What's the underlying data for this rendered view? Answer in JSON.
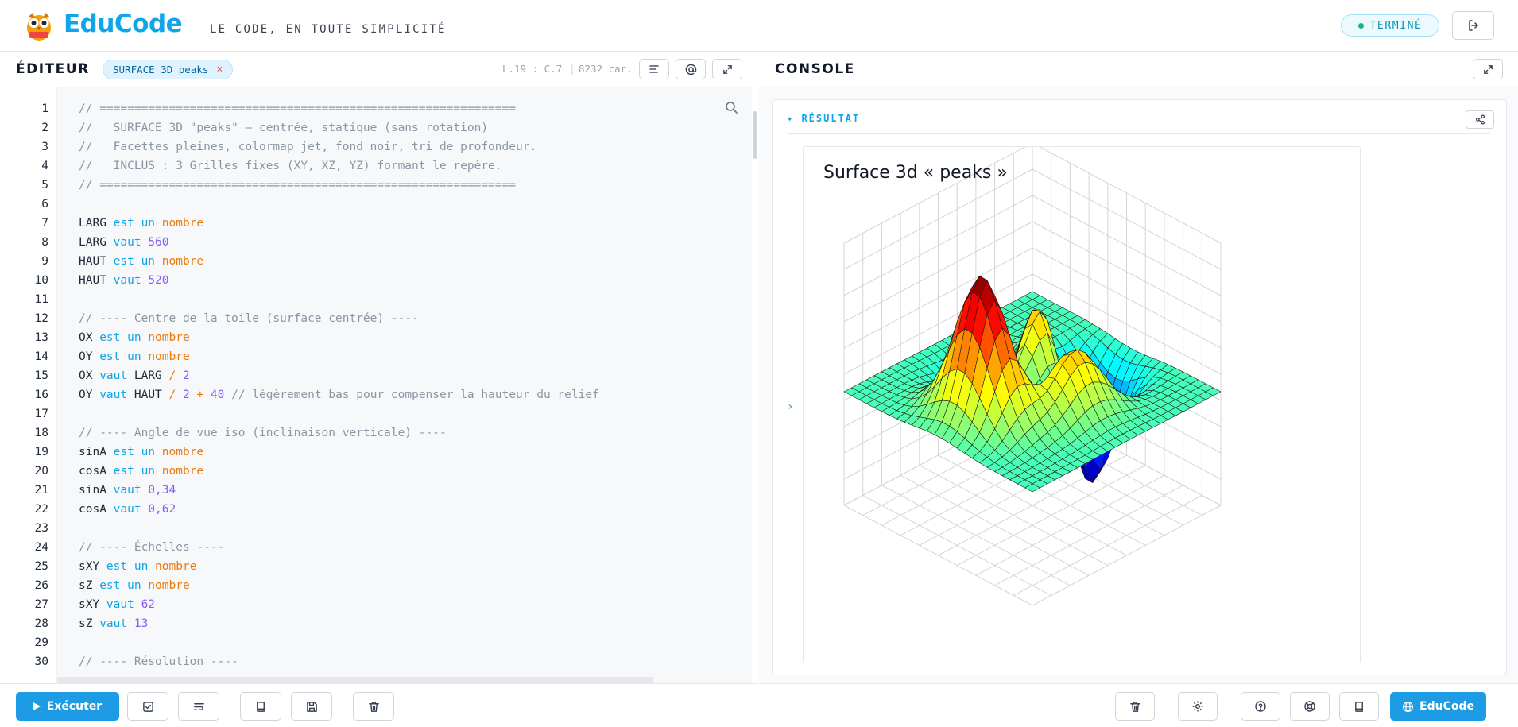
{
  "app": {
    "brand": "EduCode",
    "tagline": "LE CODE, EN TOUTE SIMPLICITÉ",
    "status": "TERMINÉ",
    "status_color": "#10b981",
    "accent": "#1d9ce5"
  },
  "editor": {
    "title": "ÉDITEUR",
    "file_tab": "SURFACE 3D peaks",
    "file_tab_close": "×",
    "cursor": "L.19 : C.7",
    "separator": "|",
    "char_count": "8232 car.",
    "line_numbers": [
      "1",
      "2",
      "3",
      "4",
      "5",
      "6",
      "7",
      "8",
      "9",
      "10",
      "11",
      "12",
      "13",
      "14",
      "15",
      "16",
      "17",
      "18",
      "19",
      "20",
      "21",
      "22",
      "23",
      "24",
      "25",
      "26",
      "27",
      "28",
      "29",
      "30"
    ],
    "lines": [
      [
        {
          "t": "// ============================================================",
          "c": "cmt"
        }
      ],
      [
        {
          "t": "//   SURFACE 3D \"peaks\" — centrée, statique (sans rotation)",
          "c": "cmt"
        }
      ],
      [
        {
          "t": "//   Facettes pleines, colormap jet, fond noir, tri de profondeur.",
          "c": "cmt"
        }
      ],
      [
        {
          "t": "//   INCLUS : 3 Grilles fixes (XY, XZ, YZ) formant le repère.",
          "c": "cmt"
        }
      ],
      [
        {
          "t": "// ============================================================",
          "c": "cmt"
        }
      ],
      [],
      [
        {
          "t": "LARG ",
          "c": ""
        },
        {
          "t": "est un",
          "c": "kw"
        },
        {
          "t": " ",
          "c": ""
        },
        {
          "t": "nombre",
          "c": "ty"
        }
      ],
      [
        {
          "t": "LARG ",
          "c": ""
        },
        {
          "t": "vaut",
          "c": "kw"
        },
        {
          "t": " ",
          "c": ""
        },
        {
          "t": "560",
          "c": "num"
        }
      ],
      [
        {
          "t": "HAUT ",
          "c": ""
        },
        {
          "t": "est un",
          "c": "kw"
        },
        {
          "t": " ",
          "c": ""
        },
        {
          "t": "nombre",
          "c": "ty"
        }
      ],
      [
        {
          "t": "HAUT ",
          "c": ""
        },
        {
          "t": "vaut",
          "c": "kw"
        },
        {
          "t": " ",
          "c": ""
        },
        {
          "t": "520",
          "c": "num"
        }
      ],
      [],
      [
        {
          "t": "// ---- Centre de la toile (surface centrée) ----",
          "c": "cmt"
        }
      ],
      [
        {
          "t": "OX ",
          "c": ""
        },
        {
          "t": "est un",
          "c": "kw"
        },
        {
          "t": " ",
          "c": ""
        },
        {
          "t": "nombre",
          "c": "ty"
        }
      ],
      [
        {
          "t": "OY ",
          "c": ""
        },
        {
          "t": "est un",
          "c": "kw"
        },
        {
          "t": " ",
          "c": ""
        },
        {
          "t": "nombre",
          "c": "ty"
        }
      ],
      [
        {
          "t": "OX ",
          "c": ""
        },
        {
          "t": "vaut",
          "c": "kw"
        },
        {
          "t": " LARG ",
          "c": ""
        },
        {
          "t": "/",
          "c": "op"
        },
        {
          "t": " ",
          "c": ""
        },
        {
          "t": "2",
          "c": "num"
        }
      ],
      [
        {
          "t": "OY ",
          "c": ""
        },
        {
          "t": "vaut",
          "c": "kw"
        },
        {
          "t": " HAUT ",
          "c": ""
        },
        {
          "t": "/",
          "c": "op"
        },
        {
          "t": " ",
          "c": ""
        },
        {
          "t": "2",
          "c": "num"
        },
        {
          "t": " ",
          "c": ""
        },
        {
          "t": "+",
          "c": "op"
        },
        {
          "t": " ",
          "c": ""
        },
        {
          "t": "40",
          "c": "num"
        },
        {
          "t": " ",
          "c": ""
        },
        {
          "t": "// légèrement bas pour compenser la hauteur du relief",
          "c": "cmt"
        }
      ],
      [],
      [
        {
          "t": "// ---- Angle de vue iso (inclinaison verticale) ----",
          "c": "cmt"
        }
      ],
      [
        {
          "t": "sinA ",
          "c": ""
        },
        {
          "t": "est un",
          "c": "kw"
        },
        {
          "t": " ",
          "c": ""
        },
        {
          "t": "nombre",
          "c": "ty"
        }
      ],
      [
        {
          "t": "cosA ",
          "c": ""
        },
        {
          "t": "est un",
          "c": "kw"
        },
        {
          "t": " ",
          "c": ""
        },
        {
          "t": "nombre",
          "c": "ty"
        }
      ],
      [
        {
          "t": "sinA ",
          "c": ""
        },
        {
          "t": "vaut",
          "c": "kw"
        },
        {
          "t": " ",
          "c": ""
        },
        {
          "t": "0,34",
          "c": "num"
        }
      ],
      [
        {
          "t": "cosA ",
          "c": ""
        },
        {
          "t": "vaut",
          "c": "kw"
        },
        {
          "t": " ",
          "c": ""
        },
        {
          "t": "0,62",
          "c": "num"
        }
      ],
      [],
      [
        {
          "t": "// ---- Échelles ----",
          "c": "cmt"
        }
      ],
      [
        {
          "t": "sXY ",
          "c": ""
        },
        {
          "t": "est un",
          "c": "kw"
        },
        {
          "t": " ",
          "c": ""
        },
        {
          "t": "nombre",
          "c": "ty"
        }
      ],
      [
        {
          "t": "sZ ",
          "c": ""
        },
        {
          "t": "est un",
          "c": "kw"
        },
        {
          "t": " ",
          "c": ""
        },
        {
          "t": "nombre",
          "c": "ty"
        }
      ],
      [
        {
          "t": "sXY ",
          "c": ""
        },
        {
          "t": "vaut",
          "c": "kw"
        },
        {
          "t": " ",
          "c": ""
        },
        {
          "t": "62",
          "c": "num"
        }
      ],
      [
        {
          "t": "sZ ",
          "c": ""
        },
        {
          "t": "vaut",
          "c": "kw"
        },
        {
          "t": " ",
          "c": ""
        },
        {
          "t": "13",
          "c": "num"
        }
      ],
      [],
      [
        {
          "t": "// ---- Résolution ----",
          "c": "cmt"
        }
      ]
    ],
    "run_label": "Exécuter"
  },
  "console": {
    "title": "CONSOLE",
    "result_label": "✦ RÉSULTAT",
    "caret": "›",
    "plot_title": "Surface 3d « peaks »",
    "educode_label": "EduCode"
  },
  "icons": {
    "logo": "owl-logo-icon",
    "logout": "logout-icon",
    "format": "align-left-icon",
    "at": "at-sign-icon",
    "expand": "expand-icon",
    "search": "search-icon",
    "run": "play-icon",
    "check": "checkbox-icon",
    "wrap": "wrap-lines-icon",
    "book": "book-icon",
    "save": "save-icon",
    "trash": "trash-icon",
    "share": "share-icon",
    "settings": "gear-icon",
    "help": "help-circle-icon",
    "support": "lifebuoy-icon",
    "globe": "globe-icon"
  },
  "chart_data": {
    "type": "surface",
    "title": "Surface 3d « peaks »",
    "function": "peaks",
    "grid_size": 25,
    "x_range": [
      -3,
      3
    ],
    "y_range": [
      -3,
      3
    ],
    "colormap": "jet",
    "grid_planes": [
      "XY",
      "XZ",
      "YZ"
    ],
    "grid": true
  }
}
